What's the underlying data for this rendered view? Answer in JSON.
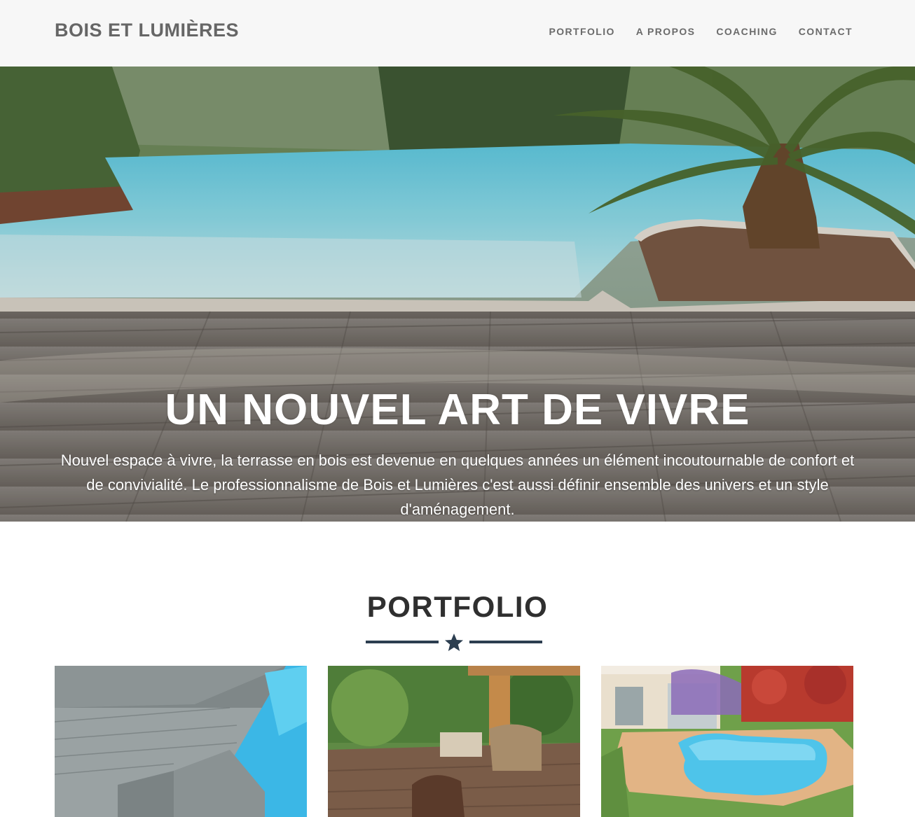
{
  "navbar": {
    "brand": "BOIS ET LUMIÈRES",
    "links": [
      "PORTFOLIO",
      "A PROPOS",
      "COACHING",
      "CONTACT"
    ]
  },
  "hero": {
    "title": "UN NOUVEL ART DE VIVRE",
    "text": "Nouvel espace à vivre, la terrasse en bois est devenue en quelques années un élément incoutournable de confort et de convivialité. Le professionnalisme de Bois et Lumières c'est aussi définir ensemble des univers et un style d'aménagement."
  },
  "portfolio": {
    "title": "PORTFOLIO",
    "divider_icon": "star-icon"
  },
  "colors": {
    "navbar_bg": "#f7f7f7",
    "brand_text": "#666666",
    "divider": "#2c3e50",
    "heading": "#2f2f2f"
  }
}
